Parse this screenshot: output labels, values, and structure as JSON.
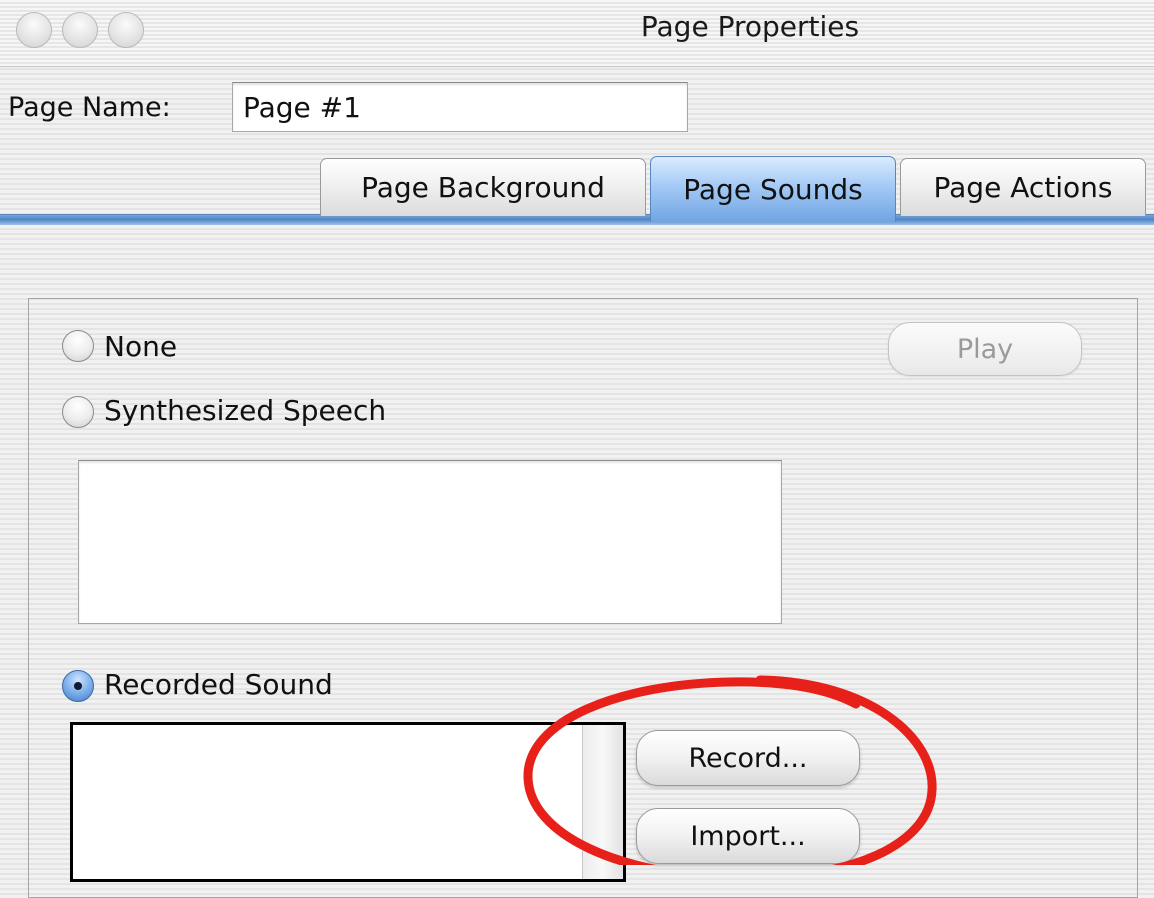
{
  "window": {
    "title": "Page Properties"
  },
  "page_name": {
    "label": "Page Name:",
    "value": "Page #1"
  },
  "tabs": [
    {
      "label": "Page Background",
      "active": false
    },
    {
      "label": "Page Sounds",
      "active": true
    },
    {
      "label": "Page Actions",
      "active": false
    }
  ],
  "sound_options": {
    "none_label": "None",
    "speech_label": "Synthesized Speech",
    "recorded_label": "Recorded Sound",
    "selected": "Recorded Sound"
  },
  "buttons": {
    "play": "Play",
    "record": "Record...",
    "import": "Import..."
  },
  "colors": {
    "annotation": "#e8201a",
    "tab_active": "#6fa4e3",
    "radio_checked": "#3f7bc6"
  }
}
